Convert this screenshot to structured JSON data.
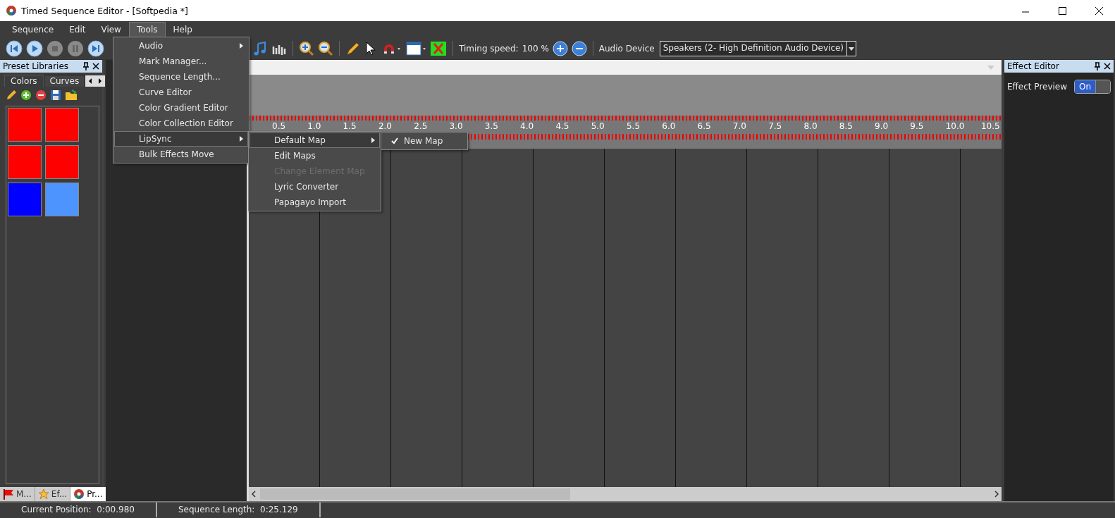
{
  "window": {
    "title": "Timed Sequence Editor - [Softpedia *]"
  },
  "menu": [
    {
      "label": "Sequence",
      "selected": false
    },
    {
      "label": "Edit",
      "selected": false
    },
    {
      "label": "View",
      "selected": false
    },
    {
      "label": "Tools",
      "selected": true
    },
    {
      "label": "Help",
      "selected": false
    }
  ],
  "tools_menu": [
    {
      "label": "Audio",
      "submenu": true,
      "selected": false
    },
    {
      "label": "Mark Manager...",
      "submenu": false,
      "selected": false
    },
    {
      "label": "Sequence Length...",
      "submenu": false,
      "selected": false
    },
    {
      "label": "Curve Editor",
      "submenu": false,
      "selected": false
    },
    {
      "label": "Color Gradient Editor",
      "submenu": false,
      "selected": false
    },
    {
      "label": "Color Collection Editor",
      "submenu": false,
      "selected": false
    },
    {
      "label": "LipSync",
      "submenu": true,
      "selected": true
    },
    {
      "label": "Bulk Effects Move",
      "submenu": false,
      "selected": false
    }
  ],
  "lipsync_menu": [
    {
      "label": "Default Map",
      "submenu": true,
      "selected": true,
      "disabled": false
    },
    {
      "label": "Edit Maps",
      "submenu": false,
      "selected": false,
      "disabled": false
    },
    {
      "label": "Change Element Map",
      "submenu": false,
      "selected": false,
      "disabled": true
    },
    {
      "label": "Lyric Converter",
      "submenu": false,
      "selected": false,
      "disabled": false
    },
    {
      "label": "Papagayo Import",
      "submenu": false,
      "selected": false,
      "disabled": false
    }
  ],
  "default_map_menu": [
    {
      "label": "New Map",
      "checked": true
    }
  ],
  "toolbar": {
    "timing_label": "Timing speed:",
    "timing_value": "100 %",
    "audio_label": "Audio Device",
    "audio_device": "Speakers (2- High Definition Audio Device)"
  },
  "preset_libraries": {
    "title": "Preset Libraries",
    "tabs": [
      {
        "label": "Colors",
        "selected": true
      },
      {
        "label": "Curves",
        "selected": false
      }
    ],
    "swatches": [
      {
        "color": "#ff0000"
      },
      {
        "color": "#ff0000"
      },
      {
        "color": "#ff0000"
      },
      {
        "color": "#ff0000"
      },
      {
        "color": "#0000ff"
      },
      {
        "color": "#4d94ff"
      }
    ],
    "bottom_tabs": [
      {
        "label": "M...",
        "selected": false,
        "kind": "flag"
      },
      {
        "label": "Ef...",
        "selected": false,
        "kind": "star"
      },
      {
        "label": "Pr...",
        "selected": true,
        "kind": "logo"
      }
    ]
  },
  "ruler": {
    "labels": [
      "0.5",
      "1.0",
      "1.5",
      "2.0",
      "2.5",
      "3.0",
      "3.5",
      "4.0",
      "4.5",
      "5.0",
      "5.5",
      "6.0",
      "6.5",
      "7.0",
      "7.5",
      "8.0",
      "8.5",
      "9.0",
      "9.5",
      "10.0",
      "10.5"
    ]
  },
  "effect_editor": {
    "title": "Effect Editor",
    "preview_label": "Effect Preview",
    "toggle": {
      "label": "On",
      "on": true
    }
  },
  "status_bar": [
    {
      "label": "Current Position:  0:00.980"
    },
    {
      "label": "Sequence Length:  0:25.129"
    }
  ]
}
